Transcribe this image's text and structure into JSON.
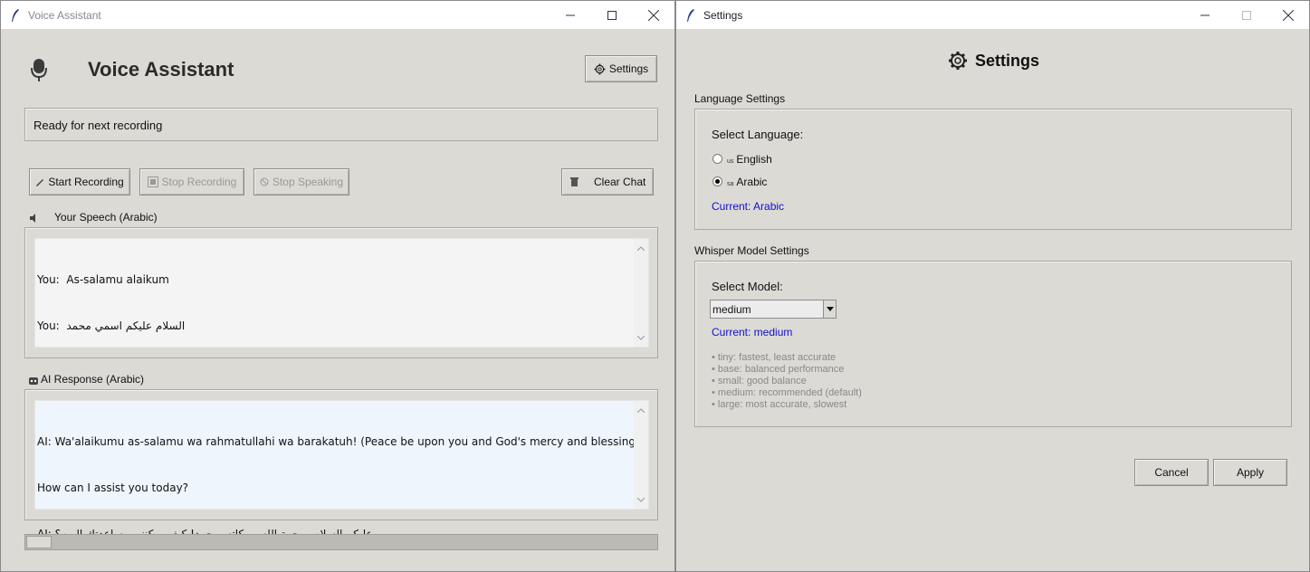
{
  "main_window": {
    "title": "Voice Assistant",
    "app_heading": "Voice Assistant",
    "settings_button": "Settings",
    "status_text": "Ready for next recording",
    "buttons": {
      "start_recording": "Start Recording",
      "stop_recording": "Stop Recording",
      "stop_speaking": "Stop Speaking",
      "clear_chat": "Clear Chat"
    },
    "speech_section": {
      "label": "Your Speech (Arabic)",
      "lines": [
        "You:  As-salamu alaikum",
        "You:  السلام عليكم اسمي محمد"
      ]
    },
    "response_section": {
      "label": "AI Response (Arabic)",
      "lines": [
        "AI: Wa'alaikumu as-salamu wa rahmatullahi wa barakatuh! (Peace be upon you and God's mercy and blessings).",
        "How can I assist you today?",
        "AI: وعليكم السلام ورحمة الله وبركاته، محمد! كيف يمكنني مساعدتك اليوم؟"
      ]
    },
    "progress": 0.04
  },
  "settings_window": {
    "title": "Settings",
    "heading": "Settings",
    "language_group": "Language Settings",
    "select_language_label": "Select Language:",
    "languages": [
      {
        "flag": "us",
        "label": "English",
        "selected": false
      },
      {
        "flag": "sa",
        "label": "Arabic",
        "selected": true
      }
    ],
    "current_language": "Current: Arabic",
    "model_group": "Whisper Model Settings",
    "select_model_label": "Select Model:",
    "model_value": "medium",
    "current_model": "Current: medium",
    "model_notes": [
      "• tiny: fastest, least accurate",
      "• base: balanced performance",
      "• small: good balance",
      "• medium: recommended (default)",
      "• large: most accurate, slowest"
    ],
    "cancel_button": "Cancel",
    "apply_button": "Apply"
  },
  "colors": {
    "window_bg": "#dcdad5",
    "accent_blue": "#1010d0",
    "response_bg": "#eef5fd"
  },
  "icons": [
    "feather-icon",
    "microphone-icon",
    "gear-icon",
    "pen-icon",
    "stop-icon",
    "mute-icon",
    "trash-icon",
    "speaker-icon",
    "robot-icon"
  ]
}
